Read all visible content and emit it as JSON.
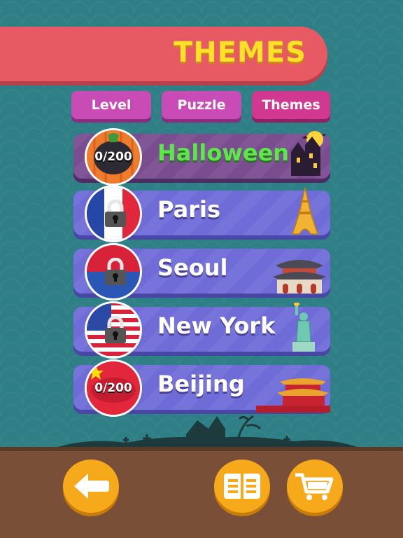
{
  "header": {
    "title": "THEMES"
  },
  "tabs": [
    {
      "label": "Level"
    },
    {
      "label": "Puzzle"
    },
    {
      "label": "Themes"
    }
  ],
  "themes": [
    {
      "name": "Halloween",
      "progress": "0/200",
      "locked": false,
      "flag": "pumpkin",
      "landmark": "haunted-house"
    },
    {
      "name": "Paris",
      "locked": true,
      "flag": "france",
      "landmark": "eiffel-tower"
    },
    {
      "name": "Seoul",
      "locked": true,
      "flag": "korea",
      "landmark": "korean-palace"
    },
    {
      "name": "New York",
      "locked": true,
      "flag": "usa",
      "landmark": "statue-of-liberty"
    },
    {
      "name": "Beijing",
      "progress": "0/200",
      "locked": false,
      "flag": "china",
      "landmark": "forbidden-city"
    }
  ],
  "colors": {
    "banner": "#e85a63",
    "title": "#ffe227",
    "tab": "#c94bb5",
    "row": "#6f6cd8",
    "halloween_row": "#7a4c90",
    "halloween_text": "#5ee64d",
    "button": "#f7a91c",
    "ground": "#7a4f37"
  },
  "bottom_bar": {
    "buttons": [
      {
        "icon": "back-arrow-icon"
      },
      {
        "icon": "book-icon"
      },
      {
        "icon": "cart-icon"
      }
    ]
  }
}
